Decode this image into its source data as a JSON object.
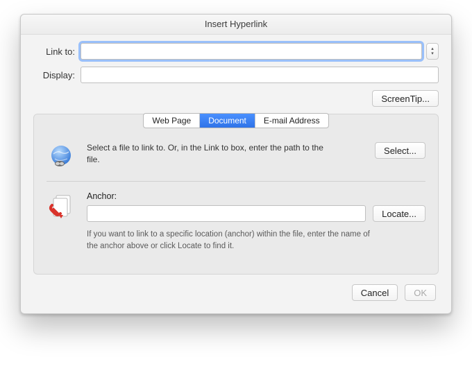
{
  "title": "Insert Hyperlink",
  "fields": {
    "link_to_label": "Link to:",
    "link_to_value": "",
    "display_label": "Display:",
    "display_value": ""
  },
  "screentip_button": "ScreenTip...",
  "tabs": {
    "web": "Web Page",
    "document": "Document",
    "email": "E-mail Address",
    "selected": "document"
  },
  "file_section": {
    "help": "Select a file to link to. Or, in the Link to box, enter the path to the file.",
    "select_button": "Select..."
  },
  "anchor_section": {
    "label": "Anchor:",
    "value": "",
    "locate_button": "Locate...",
    "help": "If you want to link to a specific location (anchor) within the file, enter the name of the anchor above or click Locate to find it."
  },
  "footer": {
    "cancel": "Cancel",
    "ok": "OK"
  }
}
